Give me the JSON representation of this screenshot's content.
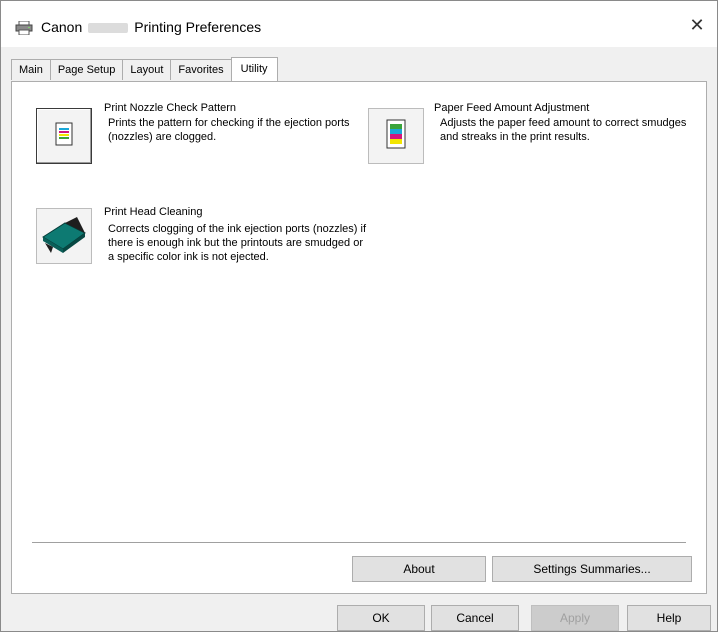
{
  "window": {
    "title_prefix": "Canon",
    "title_suffix": "Printing Preferences",
    "close_label": "✕"
  },
  "tabs": [
    {
      "label": "Main",
      "active": false
    },
    {
      "label": "Page Setup",
      "active": false
    },
    {
      "label": "Layout",
      "active": false
    },
    {
      "label": "Favorites",
      "active": false
    },
    {
      "label": "Utility",
      "active": true
    }
  ],
  "utilities": {
    "nozzle": {
      "title": "Print Nozzle Check Pattern",
      "description": "Prints the pattern for checking if the ejection ports (nozzles) are clogged.",
      "icon": "nozzle-check-icon"
    },
    "paperfeed": {
      "title": "Paper Feed Amount Adjustment",
      "description": "Adjusts the paper feed amount to correct smudges and streaks in the print results.",
      "icon": "paper-feed-icon"
    },
    "cleaning": {
      "title": "Print Head Cleaning",
      "description": "Corrects clogging of the ink ejection ports (nozzles) if there is enough ink but the printouts are smudged or a specific color ink is not ejected.",
      "icon": "print-head-icon"
    }
  },
  "panel_buttons": {
    "about": "About",
    "settings_summaries": "Settings Summaries..."
  },
  "dialog_buttons": {
    "ok": "OK",
    "cancel": "Cancel",
    "apply": "Apply",
    "help": "Help"
  },
  "colors": {
    "ink_cyan": "#1aa7d8",
    "ink_magenta": "#d2167c",
    "ink_yellow": "#f2e500",
    "ink_green": "#3aa43a",
    "print_head_teal": "#0d7a72"
  }
}
